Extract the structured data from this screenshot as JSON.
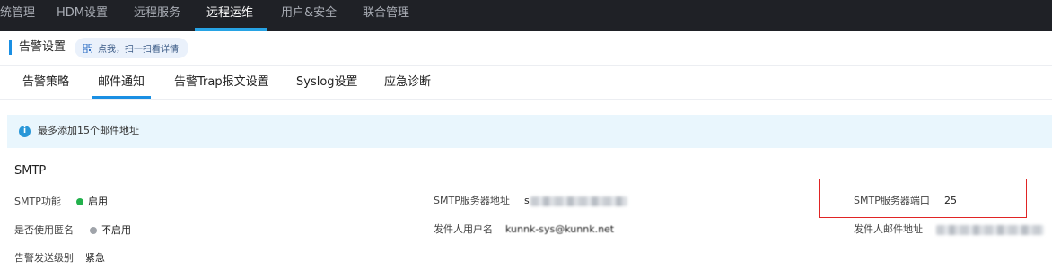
{
  "topnav": {
    "items": [
      {
        "label": "统管理",
        "active": false
      },
      {
        "label": "HDM设置",
        "active": false
      },
      {
        "label": "远程服务",
        "active": false
      },
      {
        "label": "远程运维",
        "active": true
      },
      {
        "label": "用户&安全",
        "active": false
      },
      {
        "label": "联合管理",
        "active": false
      }
    ]
  },
  "header": {
    "title": "告警设置",
    "qr_hint": "点我，扫一扫看详情",
    "qr_icon": "qr-code-icon"
  },
  "tabs": [
    {
      "label": "告警策略",
      "active": false
    },
    {
      "label": "邮件通知",
      "active": true
    },
    {
      "label": "告警Trap报文设置",
      "active": false
    },
    {
      "label": "Syslog设置",
      "active": false
    },
    {
      "label": "应急诊断",
      "active": false
    }
  ],
  "info": {
    "icon": "info-icon",
    "text": "最多添加15个邮件地址"
  },
  "smtp": {
    "section_title": "SMTP",
    "fields": {
      "smtp_function": {
        "label": "SMTP功能",
        "value": "启用",
        "status_color": "#22b14c"
      },
      "anonymous": {
        "label": "是否使用匿名",
        "value": "不启用",
        "status_color": "#a0a4aa"
      },
      "alert_level": {
        "label": "告警发送级别",
        "value": "紧急"
      },
      "server_address": {
        "label": "SMTP服务器地址",
        "value": "s"
      },
      "sender_username": {
        "label": "发件人用户名",
        "value": "kunnk-sys@kunnk.net"
      },
      "server_port": {
        "label": "SMTP服务器端口",
        "value": "25"
      },
      "sender_email": {
        "label": "发件人邮件地址",
        "value": ""
      }
    }
  },
  "colors": {
    "accent": "#1a8fe3",
    "nav_bg": "#1f2126",
    "highlight": "#e02424"
  }
}
